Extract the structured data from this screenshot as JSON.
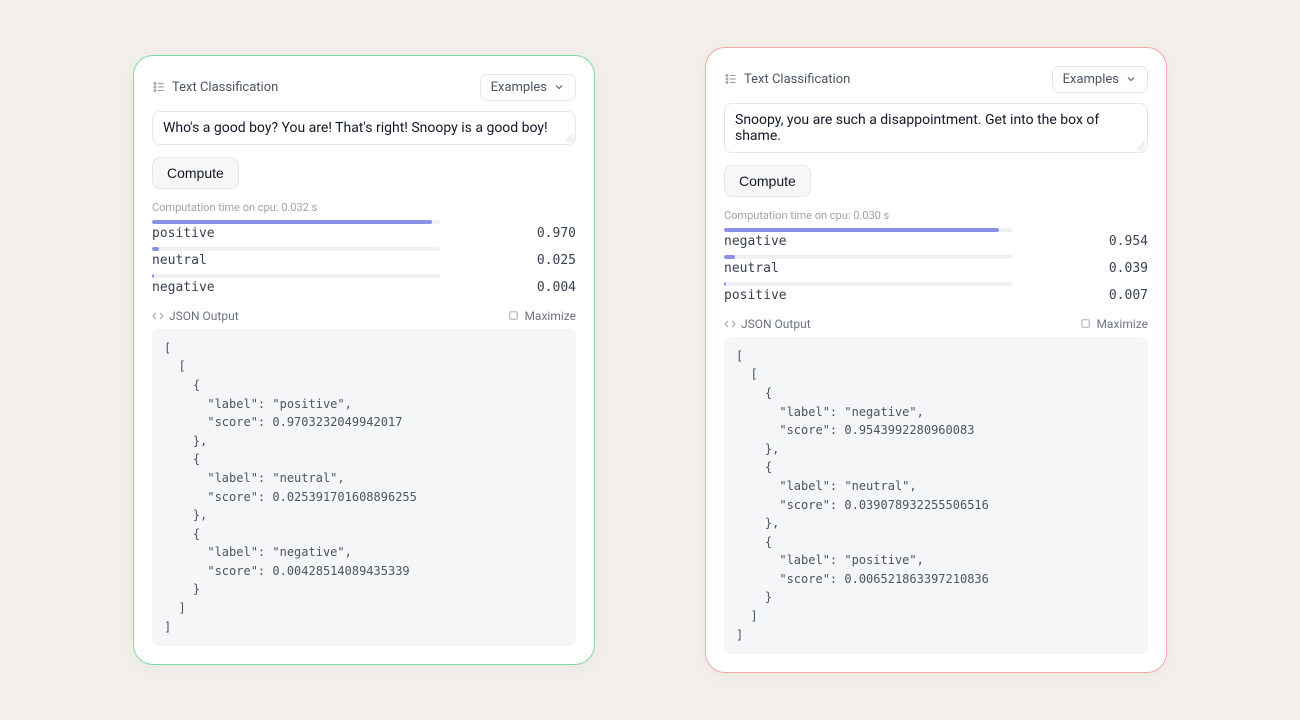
{
  "panels": [
    {
      "variant": "green",
      "title": "Text Classification",
      "examples_label": "Examples",
      "input_text": "Who's a good boy? You are! That's right! Snoopy is a good boy!",
      "compute_label": "Compute",
      "meta_text": "Computation time on cpu: 0.032 s",
      "results": [
        {
          "label": "positive",
          "score": "0.970",
          "pct": 97.0
        },
        {
          "label": "neutral",
          "score": "0.025",
          "pct": 2.5
        },
        {
          "label": "negative",
          "score": "0.004",
          "pct": 0.4
        }
      ],
      "json_label": "JSON Output",
      "maximize_label": "Maximize",
      "json_text": "[\n  [\n    {\n      \"label\": \"positive\",\n      \"score\": 0.9703232049942017\n    },\n    {\n      \"label\": \"neutral\",\n      \"score\": 0.025391701608896255\n    },\n    {\n      \"label\": \"negative\",\n      \"score\": 0.00428514089435339\n    }\n  ]\n]"
    },
    {
      "variant": "red",
      "title": "Text Classification",
      "examples_label": "Examples",
      "input_text": "Snoopy, you are such a disappointment. Get into the box of shame.",
      "compute_label": "Compute",
      "meta_text": "Computation time on cpu: 0.030 s",
      "results": [
        {
          "label": "negative",
          "score": "0.954",
          "pct": 95.4
        },
        {
          "label": "neutral",
          "score": "0.039",
          "pct": 3.9
        },
        {
          "label": "positive",
          "score": "0.007",
          "pct": 0.7
        }
      ],
      "json_label": "JSON Output",
      "maximize_label": "Maximize",
      "json_text": "[\n  [\n    {\n      \"label\": \"negative\",\n      \"score\": 0.9543992280960083\n    },\n    {\n      \"label\": \"neutral\",\n      \"score\": 0.039078932255506516\n    },\n    {\n      \"label\": \"positive\",\n      \"score\": 0.006521863397210836\n    }\n  ]\n]"
    }
  ]
}
